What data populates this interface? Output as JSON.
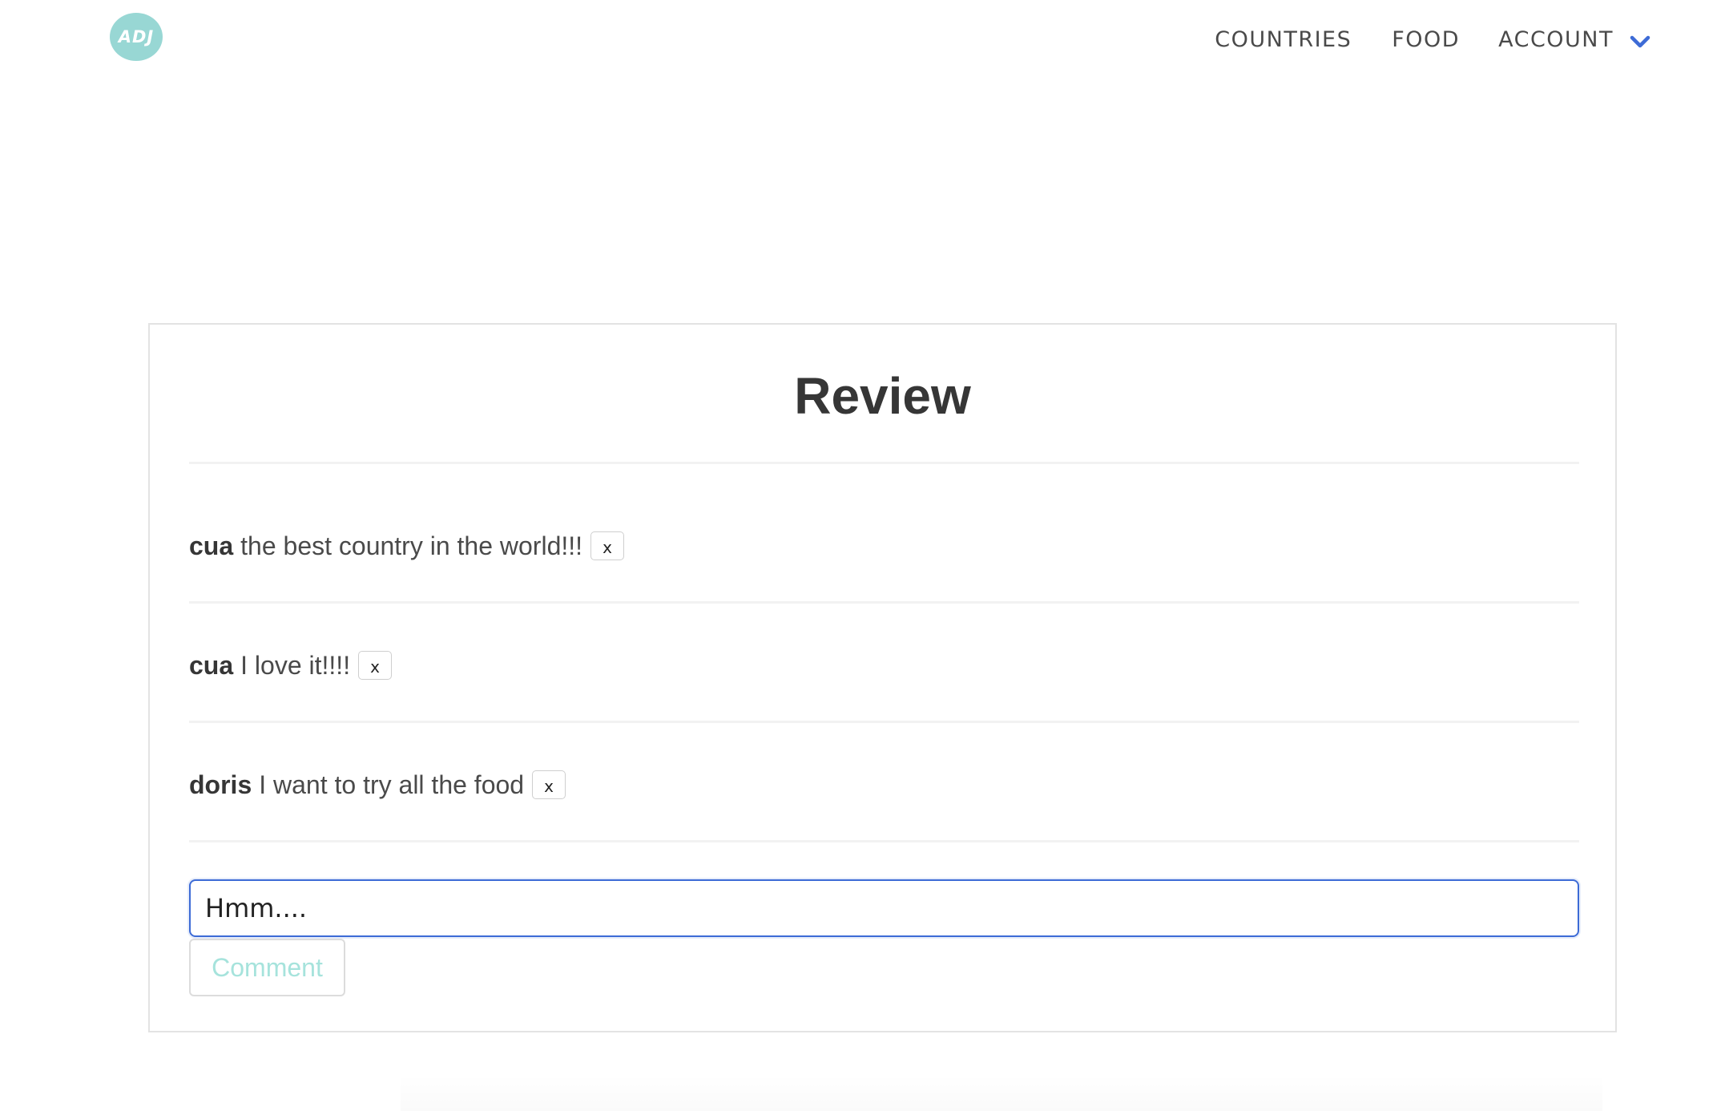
{
  "nav": {
    "logo_text": "ADJ",
    "links": [
      "COUNTRIES",
      "FOOD"
    ],
    "account_label": "ACCOUNT",
    "colors": {
      "logo": "#98d7d4",
      "chevron": "#3d6bd6"
    }
  },
  "review": {
    "title": "Review",
    "items": [
      {
        "user": "cua",
        "text": "the best country in the world!!!",
        "delete_label": "x"
      },
      {
        "user": "cua",
        "text": "I love it!!!!",
        "delete_label": "x"
      },
      {
        "user": "doris",
        "text": "I want to try all the food",
        "delete_label": "x"
      }
    ],
    "input_value": "Hmm....",
    "comment_label": "Comment",
    "colors": {
      "input_border": "#3d6bd6",
      "comment_text": "#a6e3dc"
    }
  }
}
